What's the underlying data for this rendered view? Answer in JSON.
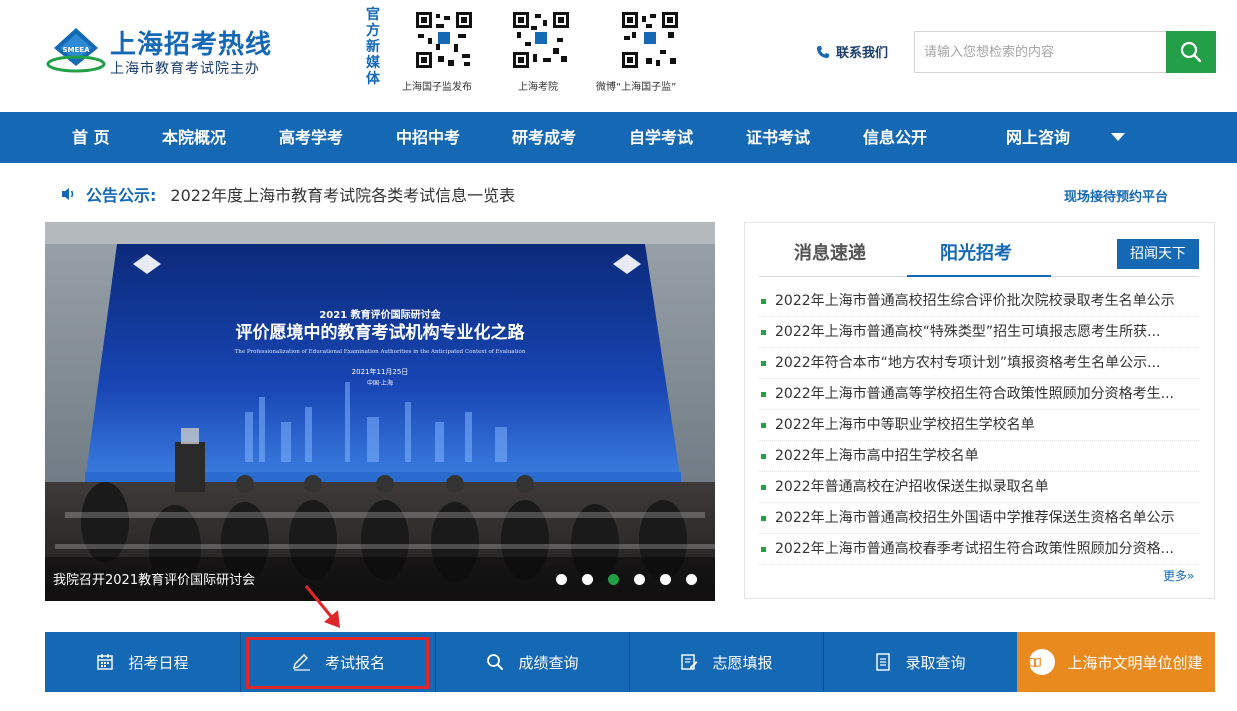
{
  "header": {
    "site_title": "上海招考热线",
    "site_subtitle": "上海市教育考试院主办",
    "logo_badge": "SMEEA",
    "media_label": "官方新媒体",
    "qr_codes": [
      {
        "caption": "上海国子监发布"
      },
      {
        "caption": "上海考院"
      },
      {
        "caption": "微博“上海国子监”"
      }
    ],
    "contact_label": "联系我们",
    "search_placeholder": "请输入您想检索的内容"
  },
  "nav": {
    "items": [
      "首 页",
      "本院概况",
      "高考学考",
      "中招中考",
      "研考成考",
      "自学考试",
      "证书考试",
      "信息公开",
      "网上咨询"
    ]
  },
  "notice": {
    "label": "公告公示:",
    "text": "2022年度上海市教育考试院各类考试信息一览表",
    "reservation": "现场接待预约平台"
  },
  "slide": {
    "caption": "我院召开2021教育评价国际研讨会",
    "screen_banner_1": "2021 教育评价国际研讨会",
    "screen_banner_2": "评价愿境中的教育考试机构专业化之路",
    "screen_banner_3": "The Professionalization of Educational Examination Authorities in the Anticipated Context of Evaluation",
    "screen_banner_4": "2021年11月25日",
    "screen_banner_5": "中国·上海",
    "dot_count": 6,
    "active_dot": 2
  },
  "news": {
    "tabs": [
      "消息速递",
      "阳光招考"
    ],
    "active_tab": 1,
    "top_button": "招闻天下",
    "items": [
      "2022年上海市普通高校招生综合评价批次院校录取考生名单公示",
      "2022年上海市普通高校“特殊类型”招生可填报志愿考生所获...",
      "2022年符合本市“地方农村专项计划”填报资格考生名单公示...",
      "2022年上海市普通高等学校招生符合政策性照顾加分资格考生...",
      "2022年上海市中等职业学校招生学校名单",
      "2022年上海市高中招生学校名单",
      "2022年普通高校在沪招收保送生拟录取名单",
      "2022年上海市普通高校招生外国语中学推荐保送生资格名单公示",
      "2022年上海市普通高校春季考试招生符合政策性照顾加分资格..."
    ],
    "more": "更多»"
  },
  "quick": {
    "items": [
      "招考日程",
      "考试报名",
      "成绩查询",
      "志愿填报",
      "录取查询",
      "上海市文明单位创建"
    ]
  },
  "colors": {
    "primary": "#1569b4",
    "green": "#23a047",
    "orange": "#e98a1f",
    "highlight": "#e0262b"
  }
}
